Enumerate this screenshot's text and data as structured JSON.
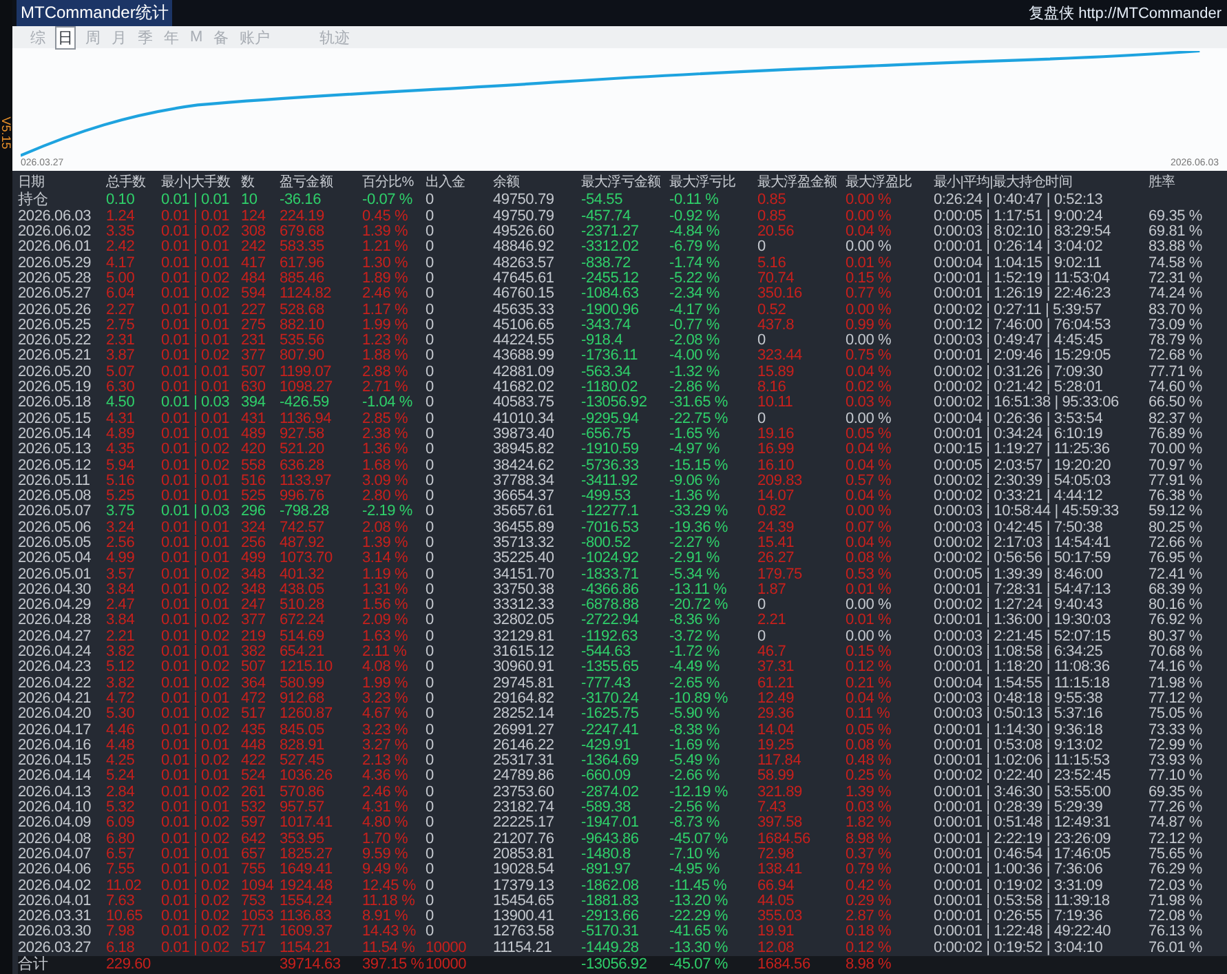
{
  "window": {
    "title": "MTCommander统计",
    "brand": "复盘侠 http://MTCommander",
    "version": "V5.15"
  },
  "tabs": [
    {
      "label": "综",
      "selected": false
    },
    {
      "label": "日",
      "selected": true
    },
    {
      "label": "周",
      "selected": false
    },
    {
      "label": "月",
      "selected": false
    },
    {
      "label": "季",
      "selected": false
    },
    {
      "label": "年",
      "selected": false
    },
    {
      "label": "M",
      "selected": false
    },
    {
      "label": "备",
      "selected": false
    },
    {
      "label": "账户",
      "selected": false
    },
    {
      "label": "轨迹",
      "selected": false
    }
  ],
  "chart": {
    "start_label": "026.03.27",
    "end_label": "2026.06.03"
  },
  "table": {
    "columns": [
      "日期",
      "总手数",
      "最小|大手数",
      "数",
      "盈亏金额",
      "百分比%",
      "出入金",
      "余额",
      "最大浮亏金额",
      "最大浮亏比",
      "最大浮盈金额",
      "最大浮盈比",
      "最小|平均|最大持仓时间",
      "胜率"
    ],
    "rows": [
      {
        "date": "持仓",
        "lots": "0.10",
        "min_max": "0.01 | 0.01",
        "count": "10",
        "pnl": "-36.16",
        "pct": "-0.07 %",
        "deposit": "0",
        "balance": "49750.79",
        "max_loss": "-54.55",
        "max_loss_pct": "-0.11 %",
        "max_gain": "0.85",
        "max_gain_pct": "0.00 %",
        "hold_time": "0:26:24 | 0:40:47 | 0:52:13",
        "gain": false,
        "float_gain": true,
        "funded": false
      },
      {
        "date": "2026.06.03",
        "lots": "1.24",
        "min_max": "0.01 | 0.01",
        "count": "124",
        "pnl": "224.19",
        "pct": "0.45 %",
        "deposit": "0",
        "balance": "49750.79",
        "max_loss": "-457.74",
        "max_loss_pct": "-0.92 %",
        "max_gain": "0.85",
        "max_gain_pct": "0.00 %",
        "hold_time": "0:00:05 | 1:17:51 | 9:00:24",
        "win_rate": "69.35 %",
        "gain": true,
        "float_gain": true,
        "funded": false
      },
      {
        "date": "2026.06.02",
        "lots": "3.35",
        "min_max": "0.01 | 0.02",
        "count": "308",
        "pnl": "679.68",
        "pct": "1.39 %",
        "deposit": "0",
        "balance": "49526.60",
        "max_loss": "-2371.27",
        "max_loss_pct": "-4.84 %",
        "max_gain": "20.56",
        "max_gain_pct": "0.04 %",
        "hold_time": "0:00:03 | 8:02:10 | 83:29:54",
        "win_rate": "69.81 %",
        "gain": true,
        "float_gain": true,
        "funded": false
      },
      {
        "date": "2026.06.01",
        "lots": "2.42",
        "min_max": "0.01 | 0.01",
        "count": "242",
        "pnl": "583.35",
        "pct": "1.21 %",
        "deposit": "0",
        "balance": "48846.92",
        "max_loss": "-3312.02",
        "max_loss_pct": "-6.79 %",
        "max_gain": "0",
        "max_gain_pct": "0.00 %",
        "hold_time": "0:00:01 | 0:26:14 | 3:04:02",
        "win_rate": "83.88 %",
        "gain": true,
        "float_gain": false,
        "funded": false
      },
      {
        "date": "2026.05.29",
        "lots": "4.17",
        "min_max": "0.01 | 0.01",
        "count": "417",
        "pnl": "617.96",
        "pct": "1.30 %",
        "deposit": "0",
        "balance": "48263.57",
        "max_loss": "-838.72",
        "max_loss_pct": "-1.74 %",
        "max_gain": "5.16",
        "max_gain_pct": "0.01 %",
        "hold_time": "0:00:04 | 1:04:15 | 9:02:11",
        "win_rate": "74.58 %",
        "gain": true,
        "float_gain": true,
        "funded": false
      },
      {
        "date": "2026.05.28",
        "lots": "5.00",
        "min_max": "0.01 | 0.02",
        "count": "484",
        "pnl": "885.46",
        "pct": "1.89 %",
        "deposit": "0",
        "balance": "47645.61",
        "max_loss": "-2455.12",
        "max_loss_pct": "-5.22 %",
        "max_gain": "70.74",
        "max_gain_pct": "0.15 %",
        "hold_time": "0:00:01 | 1:52:19 | 11:53:04",
        "win_rate": "72.31 %",
        "gain": true,
        "float_gain": true,
        "funded": false
      },
      {
        "date": "2026.05.27",
        "lots": "6.04",
        "min_max": "0.01 | 0.02",
        "count": "594",
        "pnl": "1124.82",
        "pct": "2.46 %",
        "deposit": "0",
        "balance": "46760.15",
        "max_loss": "-1084.63",
        "max_loss_pct": "-2.34 %",
        "max_gain": "350.16",
        "max_gain_pct": "0.77 %",
        "hold_time": "0:00:01 | 1:26:19 | 22:46:23",
        "win_rate": "74.24 %",
        "gain": true,
        "float_gain": true,
        "funded": false
      },
      {
        "date": "2026.05.26",
        "lots": "2.27",
        "min_max": "0.01 | 0.01",
        "count": "227",
        "pnl": "528.68",
        "pct": "1.17 %",
        "deposit": "0",
        "balance": "45635.33",
        "max_loss": "-1900.96",
        "max_loss_pct": "-4.17 %",
        "max_gain": "0.52",
        "max_gain_pct": "0.00 %",
        "hold_time": "0:00:02 | 0:27:11 | 5:39:57",
        "win_rate": "83.70 %",
        "gain": true,
        "float_gain": true,
        "funded": false
      },
      {
        "date": "2026.05.25",
        "lots": "2.75",
        "min_max": "0.01 | 0.01",
        "count": "275",
        "pnl": "882.10",
        "pct": "1.99 %",
        "deposit": "0",
        "balance": "45106.65",
        "max_loss": "-343.74",
        "max_loss_pct": "-0.77 %",
        "max_gain": "437.8",
        "max_gain_pct": "0.99 %",
        "hold_time": "0:00:12 | 7:46:00 | 76:04:53",
        "win_rate": "73.09 %",
        "gain": true,
        "float_gain": true,
        "funded": false
      },
      {
        "date": "2026.05.22",
        "lots": "2.31",
        "min_max": "0.01 | 0.01",
        "count": "231",
        "pnl": "535.56",
        "pct": "1.23 %",
        "deposit": "0",
        "balance": "44224.55",
        "max_loss": "-918.4",
        "max_loss_pct": "-2.08 %",
        "max_gain": "0",
        "max_gain_pct": "0.00 %",
        "hold_time": "0:00:03 | 0:49:47 | 4:45:45",
        "win_rate": "78.79 %",
        "gain": true,
        "float_gain": false,
        "funded": false
      },
      {
        "date": "2026.05.21",
        "lots": "3.87",
        "min_max": "0.01 | 0.02",
        "count": "377",
        "pnl": "807.90",
        "pct": "1.88 %",
        "deposit": "0",
        "balance": "43688.99",
        "max_loss": "-1736.11",
        "max_loss_pct": "-4.00 %",
        "max_gain": "323.44",
        "max_gain_pct": "0.75 %",
        "hold_time": "0:00:01 | 2:09:46 | 15:29:05",
        "win_rate": "72.68 %",
        "gain": true,
        "float_gain": true,
        "funded": false
      },
      {
        "date": "2026.05.20",
        "lots": "5.07",
        "min_max": "0.01 | 0.01",
        "count": "507",
        "pnl": "1199.07",
        "pct": "2.88 %",
        "deposit": "0",
        "balance": "42881.09",
        "max_loss": "-563.34",
        "max_loss_pct": "-1.32 %",
        "max_gain": "15.89",
        "max_gain_pct": "0.04 %",
        "hold_time": "0:00:02 | 0:31:26 | 7:09:30",
        "win_rate": "77.71 %",
        "gain": true,
        "float_gain": true,
        "funded": false
      },
      {
        "date": "2026.05.19",
        "lots": "6.30",
        "min_max": "0.01 | 0.01",
        "count": "630",
        "pnl": "1098.27",
        "pct": "2.71 %",
        "deposit": "0",
        "balance": "41682.02",
        "max_loss": "-1180.02",
        "max_loss_pct": "-2.86 %",
        "max_gain": "8.16",
        "max_gain_pct": "0.02 %",
        "hold_time": "0:00:02 | 0:21:42 | 5:28:01",
        "win_rate": "74.60 %",
        "gain": true,
        "float_gain": true,
        "funded": false
      },
      {
        "date": "2026.05.18",
        "lots": "4.50",
        "min_max": "0.01 | 0.03",
        "count": "394",
        "pnl": "-426.59",
        "pct": "-1.04 %",
        "deposit": "0",
        "balance": "40583.75",
        "max_loss": "-13056.92",
        "max_loss_pct": "-31.65 %",
        "max_gain": "10.11",
        "max_gain_pct": "0.03 %",
        "hold_time": "0:00:02 | 16:51:38 | 95:33:06",
        "win_rate": "66.50 %",
        "gain": false,
        "float_gain": true,
        "funded": false
      },
      {
        "date": "2026.05.15",
        "lots": "4.31",
        "min_max": "0.01 | 0.01",
        "count": "431",
        "pnl": "1136.94",
        "pct": "2.85 %",
        "deposit": "0",
        "balance": "41010.34",
        "max_loss": "-9295.94",
        "max_loss_pct": "-22.75 %",
        "max_gain": "0",
        "max_gain_pct": "0.00 %",
        "hold_time": "0:00:04 | 0:26:36 | 3:53:54",
        "win_rate": "82.37 %",
        "gain": true,
        "float_gain": false,
        "funded": false
      },
      {
        "date": "2026.05.14",
        "lots": "4.89",
        "min_max": "0.01 | 0.01",
        "count": "489",
        "pnl": "927.58",
        "pct": "2.38 %",
        "deposit": "0",
        "balance": "39873.40",
        "max_loss": "-656.75",
        "max_loss_pct": "-1.65 %",
        "max_gain": "19.16",
        "max_gain_pct": "0.05 %",
        "hold_time": "0:00:01 | 0:34:24 | 6:10:19",
        "win_rate": "76.89 %",
        "gain": true,
        "float_gain": true,
        "funded": false
      },
      {
        "date": "2026.05.13",
        "lots": "4.35",
        "min_max": "0.01 | 0.02",
        "count": "420",
        "pnl": "521.20",
        "pct": "1.36 %",
        "deposit": "0",
        "balance": "38945.82",
        "max_loss": "-1910.59",
        "max_loss_pct": "-4.97 %",
        "max_gain": "16.99",
        "max_gain_pct": "0.04 %",
        "hold_time": "0:00:15 | 1:19:27 | 11:25:36",
        "win_rate": "70.00 %",
        "gain": true,
        "float_gain": true,
        "funded": false
      },
      {
        "date": "2026.05.12",
        "lots": "5.94",
        "min_max": "0.01 | 0.02",
        "count": "558",
        "pnl": "636.28",
        "pct": "1.68 %",
        "deposit": "0",
        "balance": "38424.62",
        "max_loss": "-5736.33",
        "max_loss_pct": "-15.15 %",
        "max_gain": "16.10",
        "max_gain_pct": "0.04 %",
        "hold_time": "0:00:05 | 2:03:57 | 19:20:20",
        "win_rate": "70.97 %",
        "gain": true,
        "float_gain": true,
        "funded": false
      },
      {
        "date": "2026.05.11",
        "lots": "5.16",
        "min_max": "0.01 | 0.01",
        "count": "516",
        "pnl": "1133.97",
        "pct": "3.09 %",
        "deposit": "0",
        "balance": "37788.34",
        "max_loss": "-3411.92",
        "max_loss_pct": "-9.06 %",
        "max_gain": "209.83",
        "max_gain_pct": "0.57 %",
        "hold_time": "0:00:02 | 2:30:39 | 54:05:03",
        "win_rate": "77.91 %",
        "gain": true,
        "float_gain": true,
        "funded": false
      },
      {
        "date": "2026.05.08",
        "lots": "5.25",
        "min_max": "0.01 | 0.01",
        "count": "525",
        "pnl": "996.76",
        "pct": "2.80 %",
        "deposit": "0",
        "balance": "36654.37",
        "max_loss": "-499.53",
        "max_loss_pct": "-1.36 %",
        "max_gain": "14.07",
        "max_gain_pct": "0.04 %",
        "hold_time": "0:00:02 | 0:33:21 | 4:44:12",
        "win_rate": "76.38 %",
        "gain": true,
        "float_gain": true,
        "funded": false
      },
      {
        "date": "2026.05.07",
        "lots": "3.75",
        "min_max": "0.01 | 0.03",
        "count": "296",
        "pnl": "-798.28",
        "pct": "-2.19 %",
        "deposit": "0",
        "balance": "35657.61",
        "max_loss": "-12277.1",
        "max_loss_pct": "-33.29 %",
        "max_gain": "0.82",
        "max_gain_pct": "0.00 %",
        "hold_time": "0:00:03 | 10:58:44 | 45:59:33",
        "win_rate": "59.12 %",
        "gain": false,
        "float_gain": true,
        "funded": false
      },
      {
        "date": "2026.05.06",
        "lots": "3.24",
        "min_max": "0.01 | 0.01",
        "count": "324",
        "pnl": "742.57",
        "pct": "2.08 %",
        "deposit": "0",
        "balance": "36455.89",
        "max_loss": "-7016.53",
        "max_loss_pct": "-19.36 %",
        "max_gain": "24.39",
        "max_gain_pct": "0.07 %",
        "hold_time": "0:00:03 | 0:42:45 | 7:50:38",
        "win_rate": "80.25 %",
        "gain": true,
        "float_gain": true,
        "funded": false
      },
      {
        "date": "2026.05.05",
        "lots": "2.56",
        "min_max": "0.01 | 0.01",
        "count": "256",
        "pnl": "487.92",
        "pct": "1.39 %",
        "deposit": "0",
        "balance": "35713.32",
        "max_loss": "-800.52",
        "max_loss_pct": "-2.27 %",
        "max_gain": "15.41",
        "max_gain_pct": "0.04 %",
        "hold_time": "0:00:02 | 2:17:03 | 14:54:41",
        "win_rate": "72.66 %",
        "gain": true,
        "float_gain": true,
        "funded": false
      },
      {
        "date": "2026.05.04",
        "lots": "4.99",
        "min_max": "0.01 | 0.01",
        "count": "499",
        "pnl": "1073.70",
        "pct": "3.14 %",
        "deposit": "0",
        "balance": "35225.40",
        "max_loss": "-1024.92",
        "max_loss_pct": "-2.91 %",
        "max_gain": "26.27",
        "max_gain_pct": "0.08 %",
        "hold_time": "0:00:02 | 0:56:56 | 50:17:59",
        "win_rate": "76.95 %",
        "gain": true,
        "float_gain": true,
        "funded": false
      },
      {
        "date": "2026.05.01",
        "lots": "3.57",
        "min_max": "0.01 | 0.02",
        "count": "348",
        "pnl": "401.32",
        "pct": "1.19 %",
        "deposit": "0",
        "balance": "34151.70",
        "max_loss": "-1833.71",
        "max_loss_pct": "-5.34 %",
        "max_gain": "179.75",
        "max_gain_pct": "0.53 %",
        "hold_time": "0:00:05 | 1:39:39 | 8:46:00",
        "win_rate": "72.41 %",
        "gain": true,
        "float_gain": true,
        "funded": false
      },
      {
        "date": "2026.04.30",
        "lots": "3.84",
        "min_max": "0.01 | 0.02",
        "count": "348",
        "pnl": "438.05",
        "pct": "1.31 %",
        "deposit": "0",
        "balance": "33750.38",
        "max_loss": "-4366.86",
        "max_loss_pct": "-13.11 %",
        "max_gain": "1.87",
        "max_gain_pct": "0.01 %",
        "hold_time": "0:00:01 | 7:28:31 | 54:47:13",
        "win_rate": "68.39 %",
        "gain": true,
        "float_gain": true,
        "funded": false
      },
      {
        "date": "2026.04.29",
        "lots": "2.47",
        "min_max": "0.01 | 0.01",
        "count": "247",
        "pnl": "510.28",
        "pct": "1.56 %",
        "deposit": "0",
        "balance": "33312.33",
        "max_loss": "-6878.88",
        "max_loss_pct": "-20.72 %",
        "max_gain": "0",
        "max_gain_pct": "0.00 %",
        "hold_time": "0:00:02 | 1:27:24 | 9:40:43",
        "win_rate": "80.16 %",
        "gain": true,
        "float_gain": false,
        "funded": false
      },
      {
        "date": "2026.04.28",
        "lots": "3.84",
        "min_max": "0.01 | 0.02",
        "count": "377",
        "pnl": "672.24",
        "pct": "2.09 %",
        "deposit": "0",
        "balance": "32802.05",
        "max_loss": "-2722.94",
        "max_loss_pct": "-8.36 %",
        "max_gain": "2.21",
        "max_gain_pct": "0.01 %",
        "hold_time": "0:00:01 | 1:36:00 | 19:30:03",
        "win_rate": "76.92 %",
        "gain": true,
        "float_gain": true,
        "funded": false
      },
      {
        "date": "2026.04.27",
        "lots": "2.21",
        "min_max": "0.01 | 0.02",
        "count": "219",
        "pnl": "514.69",
        "pct": "1.63 %",
        "deposit": "0",
        "balance": "32129.81",
        "max_loss": "-1192.63",
        "max_loss_pct": "-3.72 %",
        "max_gain": "0",
        "max_gain_pct": "0.00 %",
        "hold_time": "0:00:03 | 2:21:45 | 52:07:15",
        "win_rate": "80.37 %",
        "gain": true,
        "float_gain": false,
        "funded": false
      },
      {
        "date": "2026.04.24",
        "lots": "3.82",
        "min_max": "0.01 | 0.01",
        "count": "382",
        "pnl": "654.21",
        "pct": "2.11 %",
        "deposit": "0",
        "balance": "31615.12",
        "max_loss": "-544.63",
        "max_loss_pct": "-1.72 %",
        "max_gain": "46.7",
        "max_gain_pct": "0.15 %",
        "hold_time": "0:00:03 | 1:08:58 | 6:34:25",
        "win_rate": "70.68 %",
        "gain": true,
        "float_gain": true,
        "funded": false
      },
      {
        "date": "2026.04.23",
        "lots": "5.12",
        "min_max": "0.01 | 0.02",
        "count": "507",
        "pnl": "1215.10",
        "pct": "4.08 %",
        "deposit": "0",
        "balance": "30960.91",
        "max_loss": "-1355.65",
        "max_loss_pct": "-4.49 %",
        "max_gain": "37.31",
        "max_gain_pct": "0.12 %",
        "hold_time": "0:00:01 | 1:18:20 | 11:08:36",
        "win_rate": "74.16 %",
        "gain": true,
        "float_gain": true,
        "funded": false
      },
      {
        "date": "2026.04.22",
        "lots": "3.82",
        "min_max": "0.01 | 0.02",
        "count": "364",
        "pnl": "580.99",
        "pct": "1.99 %",
        "deposit": "0",
        "balance": "29745.81",
        "max_loss": "-777.43",
        "max_loss_pct": "-2.65 %",
        "max_gain": "61.21",
        "max_gain_pct": "0.21 %",
        "hold_time": "0:00:04 | 1:54:55 | 11:15:18",
        "win_rate": "71.98 %",
        "gain": true,
        "float_gain": true,
        "funded": false
      },
      {
        "date": "2026.04.21",
        "lots": "4.72",
        "min_max": "0.01 | 0.01",
        "count": "472",
        "pnl": "912.68",
        "pct": "3.23 %",
        "deposit": "0",
        "balance": "29164.82",
        "max_loss": "-3170.24",
        "max_loss_pct": "-10.89 %",
        "max_gain": "12.49",
        "max_gain_pct": "0.04 %",
        "hold_time": "0:00:03 | 0:48:18 | 9:55:38",
        "win_rate": "77.12 %",
        "gain": true,
        "float_gain": true,
        "funded": false
      },
      {
        "date": "2026.04.20",
        "lots": "5.30",
        "min_max": "0.01 | 0.02",
        "count": "517",
        "pnl": "1260.87",
        "pct": "4.67 %",
        "deposit": "0",
        "balance": "28252.14",
        "max_loss": "-1625.75",
        "max_loss_pct": "-5.90 %",
        "max_gain": "29.36",
        "max_gain_pct": "0.11 %",
        "hold_time": "0:00:03 | 0:50:13 | 5:37:16",
        "win_rate": "75.05 %",
        "gain": true,
        "float_gain": true,
        "funded": false
      },
      {
        "date": "2026.04.17",
        "lots": "4.46",
        "min_max": "0.01 | 0.02",
        "count": "435",
        "pnl": "845.05",
        "pct": "3.23 %",
        "deposit": "0",
        "balance": "26991.27",
        "max_loss": "-2247.41",
        "max_loss_pct": "-8.38 %",
        "max_gain": "14.04",
        "max_gain_pct": "0.05 %",
        "hold_time": "0:00:01 | 1:14:30 | 9:36:18",
        "win_rate": "73.33 %",
        "gain": true,
        "float_gain": true,
        "funded": false
      },
      {
        "date": "2026.04.16",
        "lots": "4.48",
        "min_max": "0.01 | 0.01",
        "count": "448",
        "pnl": "828.91",
        "pct": "3.27 %",
        "deposit": "0",
        "balance": "26146.22",
        "max_loss": "-429.91",
        "max_loss_pct": "-1.69 %",
        "max_gain": "19.25",
        "max_gain_pct": "0.08 %",
        "hold_time": "0:00:01 | 0:53:08 | 9:13:02",
        "win_rate": "72.99 %",
        "gain": true,
        "float_gain": true,
        "funded": false
      },
      {
        "date": "2026.04.15",
        "lots": "4.25",
        "min_max": "0.01 | 0.02",
        "count": "422",
        "pnl": "527.45",
        "pct": "2.13 %",
        "deposit": "0",
        "balance": "25317.31",
        "max_loss": "-1364.69",
        "max_loss_pct": "-5.49 %",
        "max_gain": "117.84",
        "max_gain_pct": "0.48 %",
        "hold_time": "0:00:01 | 1:02:06 | 11:15:53",
        "win_rate": "73.93 %",
        "gain": true,
        "float_gain": true,
        "funded": false
      },
      {
        "date": "2026.04.14",
        "lots": "5.24",
        "min_max": "0.01 | 0.01",
        "count": "524",
        "pnl": "1036.26",
        "pct": "4.36 %",
        "deposit": "0",
        "balance": "24789.86",
        "max_loss": "-660.09",
        "max_loss_pct": "-2.66 %",
        "max_gain": "58.99",
        "max_gain_pct": "0.25 %",
        "hold_time": "0:00:02 | 0:22:40 | 23:52:45",
        "win_rate": "77.10 %",
        "gain": true,
        "float_gain": true,
        "funded": false
      },
      {
        "date": "2026.04.13",
        "lots": "2.84",
        "min_max": "0.01 | 0.02",
        "count": "261",
        "pnl": "570.86",
        "pct": "2.46 %",
        "deposit": "0",
        "balance": "23753.60",
        "max_loss": "-2874.02",
        "max_loss_pct": "-12.19 %",
        "max_gain": "321.89",
        "max_gain_pct": "1.39 %",
        "hold_time": "0:00:01 | 3:46:30 | 53:55:00",
        "win_rate": "69.35 %",
        "gain": true,
        "float_gain": true,
        "funded": false
      },
      {
        "date": "2026.04.10",
        "lots": "5.32",
        "min_max": "0.01 | 0.01",
        "count": "532",
        "pnl": "957.57",
        "pct": "4.31 %",
        "deposit": "0",
        "balance": "23182.74",
        "max_loss": "-589.38",
        "max_loss_pct": "-2.56 %",
        "max_gain": "7.43",
        "max_gain_pct": "0.03 %",
        "hold_time": "0:00:01 | 0:28:39 | 5:29:39",
        "win_rate": "77.26 %",
        "gain": true,
        "float_gain": true,
        "funded": false
      },
      {
        "date": "2026.04.09",
        "lots": "6.09",
        "min_max": "0.01 | 0.02",
        "count": "597",
        "pnl": "1017.41",
        "pct": "4.80 %",
        "deposit": "0",
        "balance": "22225.17",
        "max_loss": "-1947.01",
        "max_loss_pct": "-8.73 %",
        "max_gain": "397.58",
        "max_gain_pct": "1.82 %",
        "hold_time": "0:00:01 | 0:51:48 | 12:49:31",
        "win_rate": "74.87 %",
        "gain": true,
        "float_gain": true,
        "funded": false
      },
      {
        "date": "2026.04.08",
        "lots": "6.80",
        "min_max": "0.01 | 0.02",
        "count": "642",
        "pnl": "353.95",
        "pct": "1.70 %",
        "deposit": "0",
        "balance": "21207.76",
        "max_loss": "-9643.86",
        "max_loss_pct": "-45.07 %",
        "max_gain": "1684.56",
        "max_gain_pct": "8.98 %",
        "hold_time": "0:00:01 | 2:22:19 | 23:26:09",
        "win_rate": "72.12 %",
        "gain": true,
        "float_gain": true,
        "funded": false
      },
      {
        "date": "2026.04.07",
        "lots": "6.57",
        "min_max": "0.01 | 0.01",
        "count": "657",
        "pnl": "1825.27",
        "pct": "9.59 %",
        "deposit": "0",
        "balance": "20853.81",
        "max_loss": "-1480.8",
        "max_loss_pct": "-7.10 %",
        "max_gain": "72.98",
        "max_gain_pct": "0.37 %",
        "hold_time": "0:00:01 | 0:46:54 | 17:46:05",
        "win_rate": "75.65 %",
        "gain": true,
        "float_gain": true,
        "funded": false
      },
      {
        "date": "2026.04.06",
        "lots": "7.55",
        "min_max": "0.01 | 0.01",
        "count": "755",
        "pnl": "1649.41",
        "pct": "9.49 %",
        "deposit": "0",
        "balance": "19028.54",
        "max_loss": "-891.97",
        "max_loss_pct": "-4.95 %",
        "max_gain": "138.41",
        "max_gain_pct": "0.79 %",
        "hold_time": "0:00:01 | 1:00:36 | 7:36:06",
        "win_rate": "76.29 %",
        "gain": true,
        "float_gain": true,
        "funded": false
      },
      {
        "date": "2026.04.02",
        "lots": "11.02",
        "min_max": "0.01 | 0.02",
        "count": "1094",
        "pnl": "1924.48",
        "pct": "12.45 %",
        "deposit": "0",
        "balance": "17379.13",
        "max_loss": "-1862.08",
        "max_loss_pct": "-11.45 %",
        "max_gain": "66.94",
        "max_gain_pct": "0.42 %",
        "hold_time": "0:00:01 | 0:19:02 | 3:31:09",
        "win_rate": "72.03 %",
        "gain": true,
        "float_gain": true,
        "funded": false
      },
      {
        "date": "2026.04.01",
        "lots": "7.63",
        "min_max": "0.01 | 0.02",
        "count": "753",
        "pnl": "1554.24",
        "pct": "11.18 %",
        "deposit": "0",
        "balance": "15454.65",
        "max_loss": "-1881.83",
        "max_loss_pct": "-13.20 %",
        "max_gain": "44.05",
        "max_gain_pct": "0.29 %",
        "hold_time": "0:00:01 | 0:53:58 | 11:39:18",
        "win_rate": "71.98 %",
        "gain": true,
        "float_gain": true,
        "funded": false
      },
      {
        "date": "2026.03.31",
        "lots": "10.65",
        "min_max": "0.01 | 0.02",
        "count": "1053",
        "pnl": "1136.83",
        "pct": "8.91 %",
        "deposit": "0",
        "balance": "13900.41",
        "max_loss": "-2913.66",
        "max_loss_pct": "-22.29 %",
        "max_gain": "355.03",
        "max_gain_pct": "2.87 %",
        "hold_time": "0:00:01 | 0:26:55 | 7:19:36",
        "win_rate": "72.08 %",
        "gain": true,
        "float_gain": true,
        "funded": false
      },
      {
        "date": "2026.03.30",
        "lots": "7.98",
        "min_max": "0.01 | 0.02",
        "count": "771",
        "pnl": "1609.37",
        "pct": "14.43 %",
        "deposit": "0",
        "balance": "12763.58",
        "max_loss": "-5170.31",
        "max_loss_pct": "-41.65 %",
        "max_gain": "19.91",
        "max_gain_pct": "0.18 %",
        "hold_time": "0:00:01 | 1:22:48 | 49:22:40",
        "win_rate": "76.13 %",
        "gain": true,
        "float_gain": true,
        "funded": false
      },
      {
        "date": "2026.03.27",
        "lots": "6.18",
        "min_max": "0.01 | 0.02",
        "count": "517",
        "pnl": "1154.21",
        "pct": "11.54 %",
        "deposit": "10000",
        "balance": "11154.21",
        "max_loss": "-1449.28",
        "max_loss_pct": "-13.30 %",
        "max_gain": "12.08",
        "max_gain_pct": "0.12 %",
        "hold_time": "0:00:02 | 0:19:52 | 3:04:10",
        "win_rate": "76.01 %",
        "gain": true,
        "float_gain": true,
        "funded": true
      }
    ],
    "total": {
      "date": "合计",
      "lots": "229.60",
      "pnl": "39714.63",
      "pct": "397.15 %",
      "deposit": "10000",
      "max_loss": "-13056.92",
      "max_loss_pct": "-45.07 %",
      "max_gain": "1684.56",
      "max_gain_pct": "8.98 %",
      "gain": true,
      "float_gain": true,
      "funded": true
    }
  }
}
